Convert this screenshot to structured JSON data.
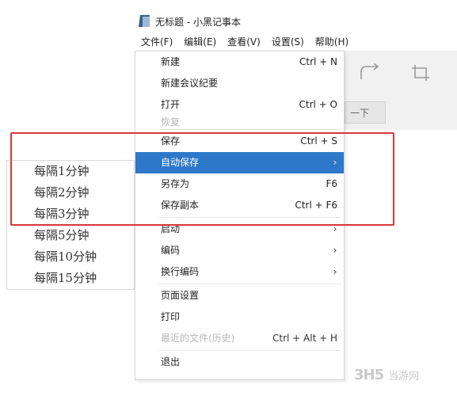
{
  "window": {
    "title": "无标题 - 小黑记事本"
  },
  "menubar": {
    "items": [
      "文件(F)",
      "编辑(E)",
      "查看(V)",
      "设置(S)",
      "帮助(H)"
    ]
  },
  "toolbar": {
    "next_label": "一下",
    "icons": [
      "redo-icon",
      "crop-icon"
    ]
  },
  "file_menu": {
    "items": [
      {
        "label": "新建",
        "shortcut": "Ctrl + N"
      },
      {
        "label": "新建会议纪要",
        "shortcut": ""
      },
      {
        "label": "打开",
        "shortcut": "Ctrl + O"
      },
      {
        "label": "恢复",
        "shortcut": ""
      },
      {
        "label": "保存",
        "shortcut": "Ctrl + S"
      },
      {
        "label": "自动保存",
        "shortcut": "›"
      },
      {
        "label": "另存为",
        "shortcut": "F6"
      },
      {
        "label": "保存副本",
        "shortcut": "Ctrl + F6"
      },
      {
        "label": "启动",
        "shortcut": "›"
      },
      {
        "label": "编码",
        "shortcut": "›"
      },
      {
        "label": "换行编码",
        "shortcut": "›"
      },
      {
        "label": "页面设置",
        "shortcut": ""
      },
      {
        "label": "打印",
        "shortcut": ""
      },
      {
        "label": "最近的文件(历史)",
        "shortcut": "Ctrl + Alt + H"
      },
      {
        "label": "退出",
        "shortcut": ""
      }
    ],
    "highlight_color": "#2d78c8"
  },
  "autosave_submenu": {
    "items": [
      "每隔1分钟",
      "每隔2分钟",
      "每隔3分钟",
      "每隔5分钟",
      "每隔10分钟",
      "每隔15分钟"
    ]
  },
  "annotation": {
    "color": "#d7383b"
  },
  "watermark": {
    "logo": "3H5",
    "text": "当游网"
  }
}
